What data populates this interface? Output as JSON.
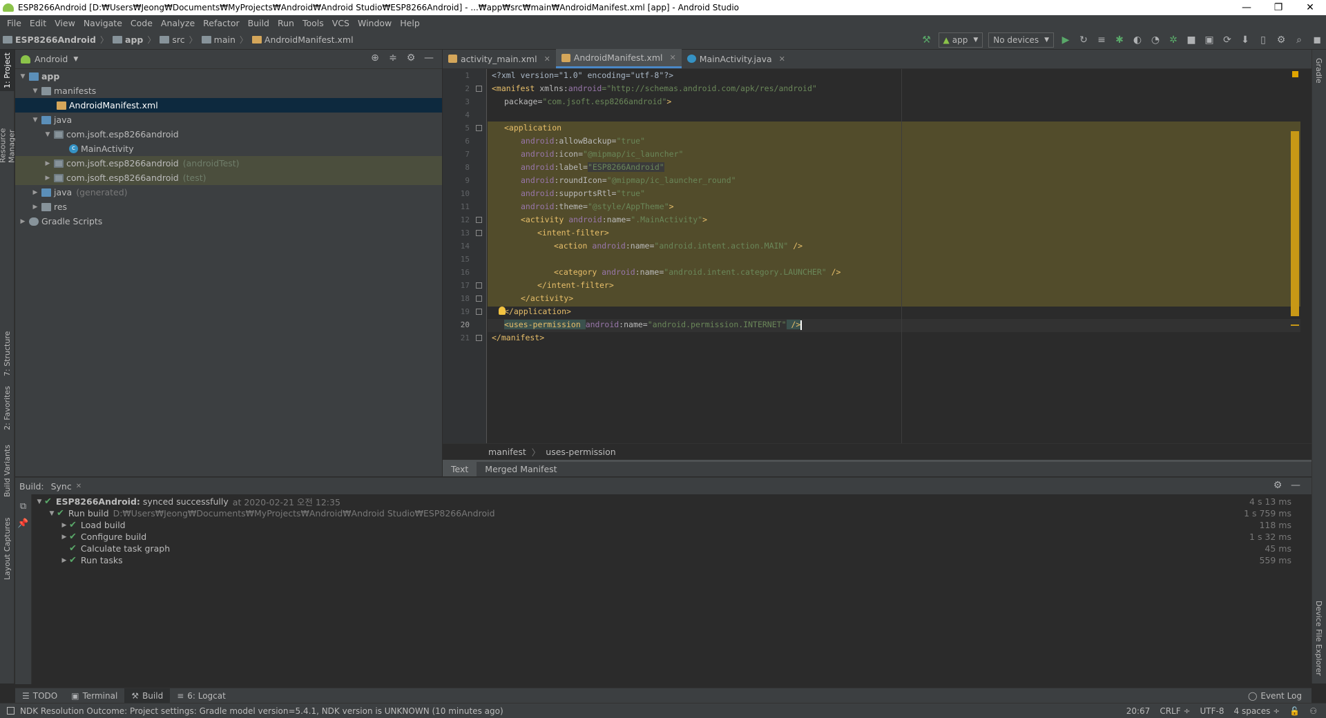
{
  "window": {
    "title": "ESP8266Android [D:₩Users₩Jeong₩Documents₩MyProjects₩Android₩Android Studio₩ESP8266Android] - ...₩app₩src₩main₩AndroidManifest.xml [app] - Android Studio",
    "minimize": "—",
    "restore": "❐",
    "close": "✕"
  },
  "menu": [
    "File",
    "Edit",
    "View",
    "Navigate",
    "Code",
    "Analyze",
    "Refactor",
    "Build",
    "Run",
    "Tools",
    "VCS",
    "Window",
    "Help"
  ],
  "breadcrumb": [
    "ESP8266Android",
    "app",
    "src",
    "main",
    "AndroidManifest.xml"
  ],
  "toolbar": {
    "run_config": "app",
    "device": "No devices"
  },
  "left_strip": {
    "project": "1: Project",
    "resource_manager": "Resource Manager",
    "structure": "7: Structure",
    "favorites": "2: Favorites",
    "build_variants": "Build Variants",
    "layout_captures": "Layout Captures"
  },
  "right_strip": {
    "gradle": "Gradle",
    "device_file_explorer": "Device File Explorer"
  },
  "project_panel": {
    "view": "Android",
    "tree": [
      {
        "label": "app",
        "extra": ""
      },
      {
        "label": "manifests",
        "extra": ""
      },
      {
        "label": "AndroidManifest.xml",
        "extra": ""
      },
      {
        "label": "java",
        "extra": ""
      },
      {
        "label": "com.jsoft.esp8266android",
        "extra": ""
      },
      {
        "label": "MainActivity",
        "extra": ""
      },
      {
        "label": "com.jsoft.esp8266android",
        "extra": "(androidTest)"
      },
      {
        "label": "com.jsoft.esp8266android",
        "extra": "(test)"
      },
      {
        "label": "java",
        "extra": "(generated)"
      },
      {
        "label": "res",
        "extra": ""
      },
      {
        "label": "Gradle Scripts",
        "extra": ""
      }
    ]
  },
  "editor": {
    "tabs": [
      "activity_main.xml",
      "AndroidManifest.xml",
      "MainActivity.java"
    ],
    "active_tab": "AndroidManifest.xml",
    "line_numbers": [
      "1",
      "2",
      "3",
      "4",
      "5",
      "6",
      "7",
      "8",
      "9",
      "10",
      "11",
      "12",
      "13",
      "14",
      "15",
      "16",
      "17",
      "18",
      "19",
      "20",
      "21"
    ],
    "current_line": 20,
    "code": {
      "l1": "<?xml version=\"1.0\" encoding=\"utf-8\"?>",
      "l2_tag": "<manifest ",
      "l2_ns": "xmlns:",
      "l2_attr": "android",
      "l2_val": "=\"http://schemas.android.com/apk/res/android\"",
      "l3_attr": "package=",
      "l3_val": "\"com.jsoft.esp8266android\"",
      "l3_end": ">",
      "l5": "<application",
      "l6_ns": "android",
      "l6_attr": ":allowBackup=",
      "l6_val": "\"true\"",
      "l7_ns": "android",
      "l7_attr": ":icon=",
      "l7_val": "\"@mipmap/ic_launcher\"",
      "l8_ns": "android",
      "l8_attr": ":label=",
      "l8_val": "\"ESP8266Android\"",
      "l9_ns": "android",
      "l9_attr": ":roundIcon=",
      "l9_val": "\"@mipmap/ic_launcher_round\"",
      "l10_ns": "android",
      "l10_attr": ":supportsRtl=",
      "l10_val": "\"true\"",
      "l11_ns": "android",
      "l11_attr": ":theme=",
      "l11_val": "\"@style/AppTheme\"",
      "l11_end": ">",
      "l12_tag": "<activity ",
      "l12_ns": "android",
      "l12_attr": ":name=",
      "l12_val": "\".MainActivity\"",
      "l12_end": ">",
      "l13": "<intent-filter>",
      "l14_tag": "<action ",
      "l14_ns": "android",
      "l14_attr": ":name=",
      "l14_val": "\"android.intent.action.MAIN\"",
      "l14_end": " />",
      "l16_tag": "<category ",
      "l16_ns": "android",
      "l16_attr": ":name=",
      "l16_val": "\"android.intent.category.LAUNCHER\"",
      "l16_end": " />",
      "l17": "</intent-filter>",
      "l18": "</activity>",
      "l19": "</application>",
      "l20_tag": "<uses-permission ",
      "l20_ns": "android",
      "l20_attr": ":name=",
      "l20_val": "\"android.permission.INTERNET\"",
      "l20_end": " />",
      "l21": "</manifest>"
    },
    "path": [
      "manifest",
      "uses-permission"
    ],
    "bottom_tabs": [
      "Text",
      "Merged Manifest"
    ]
  },
  "build": {
    "label": "Build:",
    "tab": "Sync",
    "rows": [
      {
        "name": "ESP8266Android:",
        "status": "synced successfully",
        "detail": "at 2020-02-21 오전 12:35",
        "time": "4 s 13 ms"
      },
      {
        "name": "Run build",
        "detail": "D:₩Users₩Jeong₩Documents₩MyProjects₩Android₩Android Studio₩ESP8266Android",
        "time": "1 s 759 ms"
      },
      {
        "name": "Load build",
        "time": "118 ms"
      },
      {
        "name": "Configure build",
        "time": "1 s 32 ms"
      },
      {
        "name": "Calculate task graph",
        "time": "45 ms"
      },
      {
        "name": "Run tasks",
        "time": "559 ms"
      }
    ]
  },
  "tool_tabs": [
    "TODO",
    "Terminal",
    "Build",
    "6: Logcat"
  ],
  "event_log": "Event Log",
  "status": {
    "message": "NDK Resolution Outcome: Project settings: Gradle model version=5.4.1, NDK version is UNKNOWN (10 minutes ago)",
    "position": "20:67",
    "line_sep": "CRLF ÷",
    "encoding": "UTF-8",
    "indent": "4 spaces ÷"
  }
}
